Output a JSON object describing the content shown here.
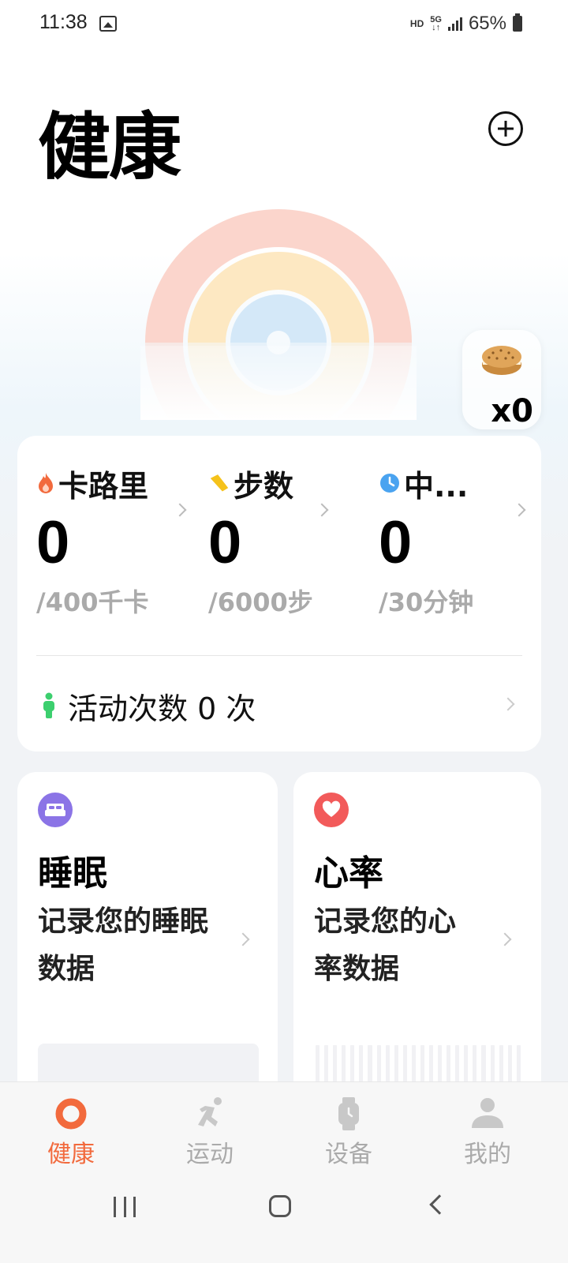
{
  "status_bar": {
    "time": "11:38",
    "hd": "HD",
    "network": "5G",
    "battery": "65%"
  },
  "header": {
    "title": "健康"
  },
  "rewards": {
    "count": "x0"
  },
  "activity": {
    "metrics": [
      {
        "label": "卡路里",
        "value": "0",
        "goal": "/400千卡",
        "icon": "flame-icon",
        "color": "#f26a3d"
      },
      {
        "label": "步数",
        "value": "0",
        "goal": "/6000步",
        "icon": "footprint-icon",
        "color": "#f5c21b"
      },
      {
        "label": "中...",
        "value": "0",
        "goal": "/30分钟",
        "icon": "clock-icon",
        "color": "#4aa3f0"
      }
    ],
    "sessions_label": "活动次数 0 次"
  },
  "cards": {
    "sleep": {
      "title": "睡眠",
      "desc": "记录您的睡眠数据",
      "color": "#8b74e6"
    },
    "heart": {
      "title": "心率",
      "desc": "记录您的心率数据",
      "color": "#f25a5a"
    }
  },
  "nav": {
    "items": [
      {
        "label": "健康",
        "active": true
      },
      {
        "label": "运动",
        "active": false
      },
      {
        "label": "设备",
        "active": false
      },
      {
        "label": "我的",
        "active": false
      }
    ]
  },
  "colors": {
    "accent": "#f26a3d",
    "ring_outer": "#fbd5cc",
    "ring_middle": "#fde8c2",
    "ring_inner": "#d4e8f8"
  }
}
